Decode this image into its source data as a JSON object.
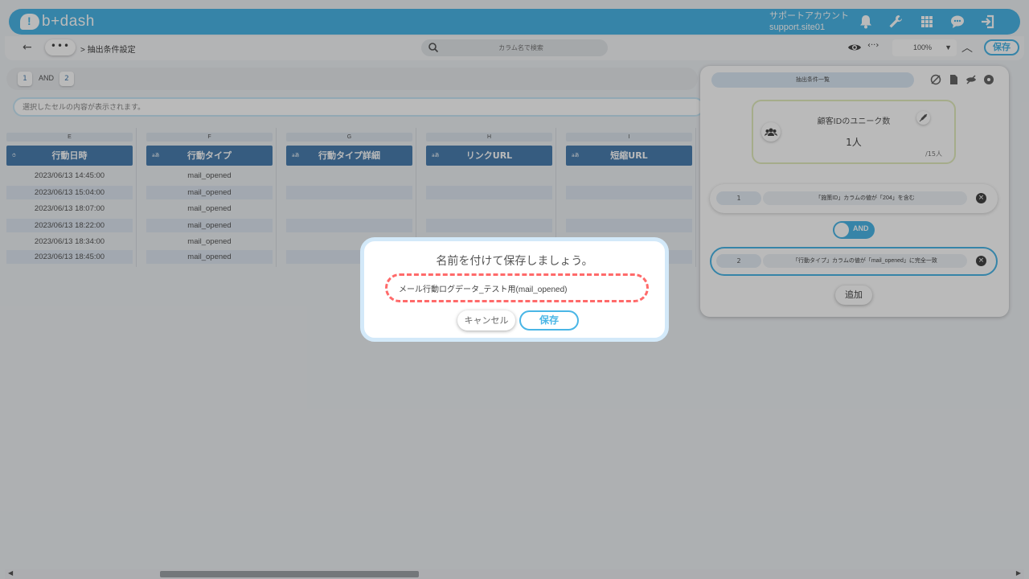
{
  "header": {
    "logo_text": "b+dash",
    "account_label": "サポートアカウント",
    "account_site": "support.site01",
    "icons": [
      "bell-icon",
      "wrench-icon",
      "apps-grid-icon",
      "support-chat-icon",
      "logout-icon"
    ]
  },
  "subbar": {
    "back_icon": "←",
    "more_label": "•••",
    "breadcrumb": "> 抽出条件設定",
    "search_placeholder": "カラム名で検索",
    "code_icon": "‹··›",
    "zoom_value": "100%",
    "save_label": "保存"
  },
  "condition_bar": {
    "chip1": "1",
    "and_label": "AND",
    "chip2": "2"
  },
  "selected_cell_text": "選択したセルの内容が表示されます。",
  "columns": [
    {
      "letter": "E",
      "header": "行動日時",
      "type_label": "",
      "cells": [
        "2023/06/13 14:45:00",
        "2023/06/13 15:04:00",
        "2023/06/13 18:07:00",
        "2023/06/13 18:22:00",
        "2023/06/13 18:34:00",
        "2023/06/13 18:45:00"
      ]
    },
    {
      "letter": "F",
      "header": "行動タイプ",
      "type_label": "aあ",
      "cells": [
        "mail_opened",
        "mail_opened",
        "mail_opened",
        "mail_opened",
        "mail_opened",
        "mail_opened"
      ]
    },
    {
      "letter": "G",
      "header": "行動タイプ詳細",
      "type_label": "aあ",
      "cells": [
        "",
        "",
        "",
        "",
        "",
        ""
      ]
    },
    {
      "letter": "H",
      "header": "リンクURL",
      "type_label": "aあ",
      "cells": [
        "",
        "",
        "",
        "",
        "",
        ""
      ]
    },
    {
      "letter": "I",
      "header": "短縮URL",
      "type_label": "aあ",
      "cells": [
        "",
        "",
        "",
        "",
        "",
        ""
      ]
    }
  ],
  "panel": {
    "tab_label": "抽出条件一覧",
    "count_title": "顧客IDのユニーク数",
    "count_value": "1人",
    "count_total": "/15人",
    "conditions": [
      {
        "num": "1",
        "text": "「施策ID」カラムの値が「204」を含む"
      },
      {
        "num": "2",
        "text": "「行動タイプ」カラムの値が「mail_opened」に完全一致"
      }
    ],
    "and_toggle": "AND",
    "add_label": "追加"
  },
  "modal": {
    "title": "名前を付けて保存しましょう。",
    "input_value": "メール行動ログデータ_テスト用(mail_opened)",
    "cancel_label": "キャンセル",
    "save_label": "保存"
  },
  "colors": {
    "accent": "#4ab6e6",
    "column_header": "#4a7fb0",
    "dashed_highlight": "#ff6a6a"
  }
}
